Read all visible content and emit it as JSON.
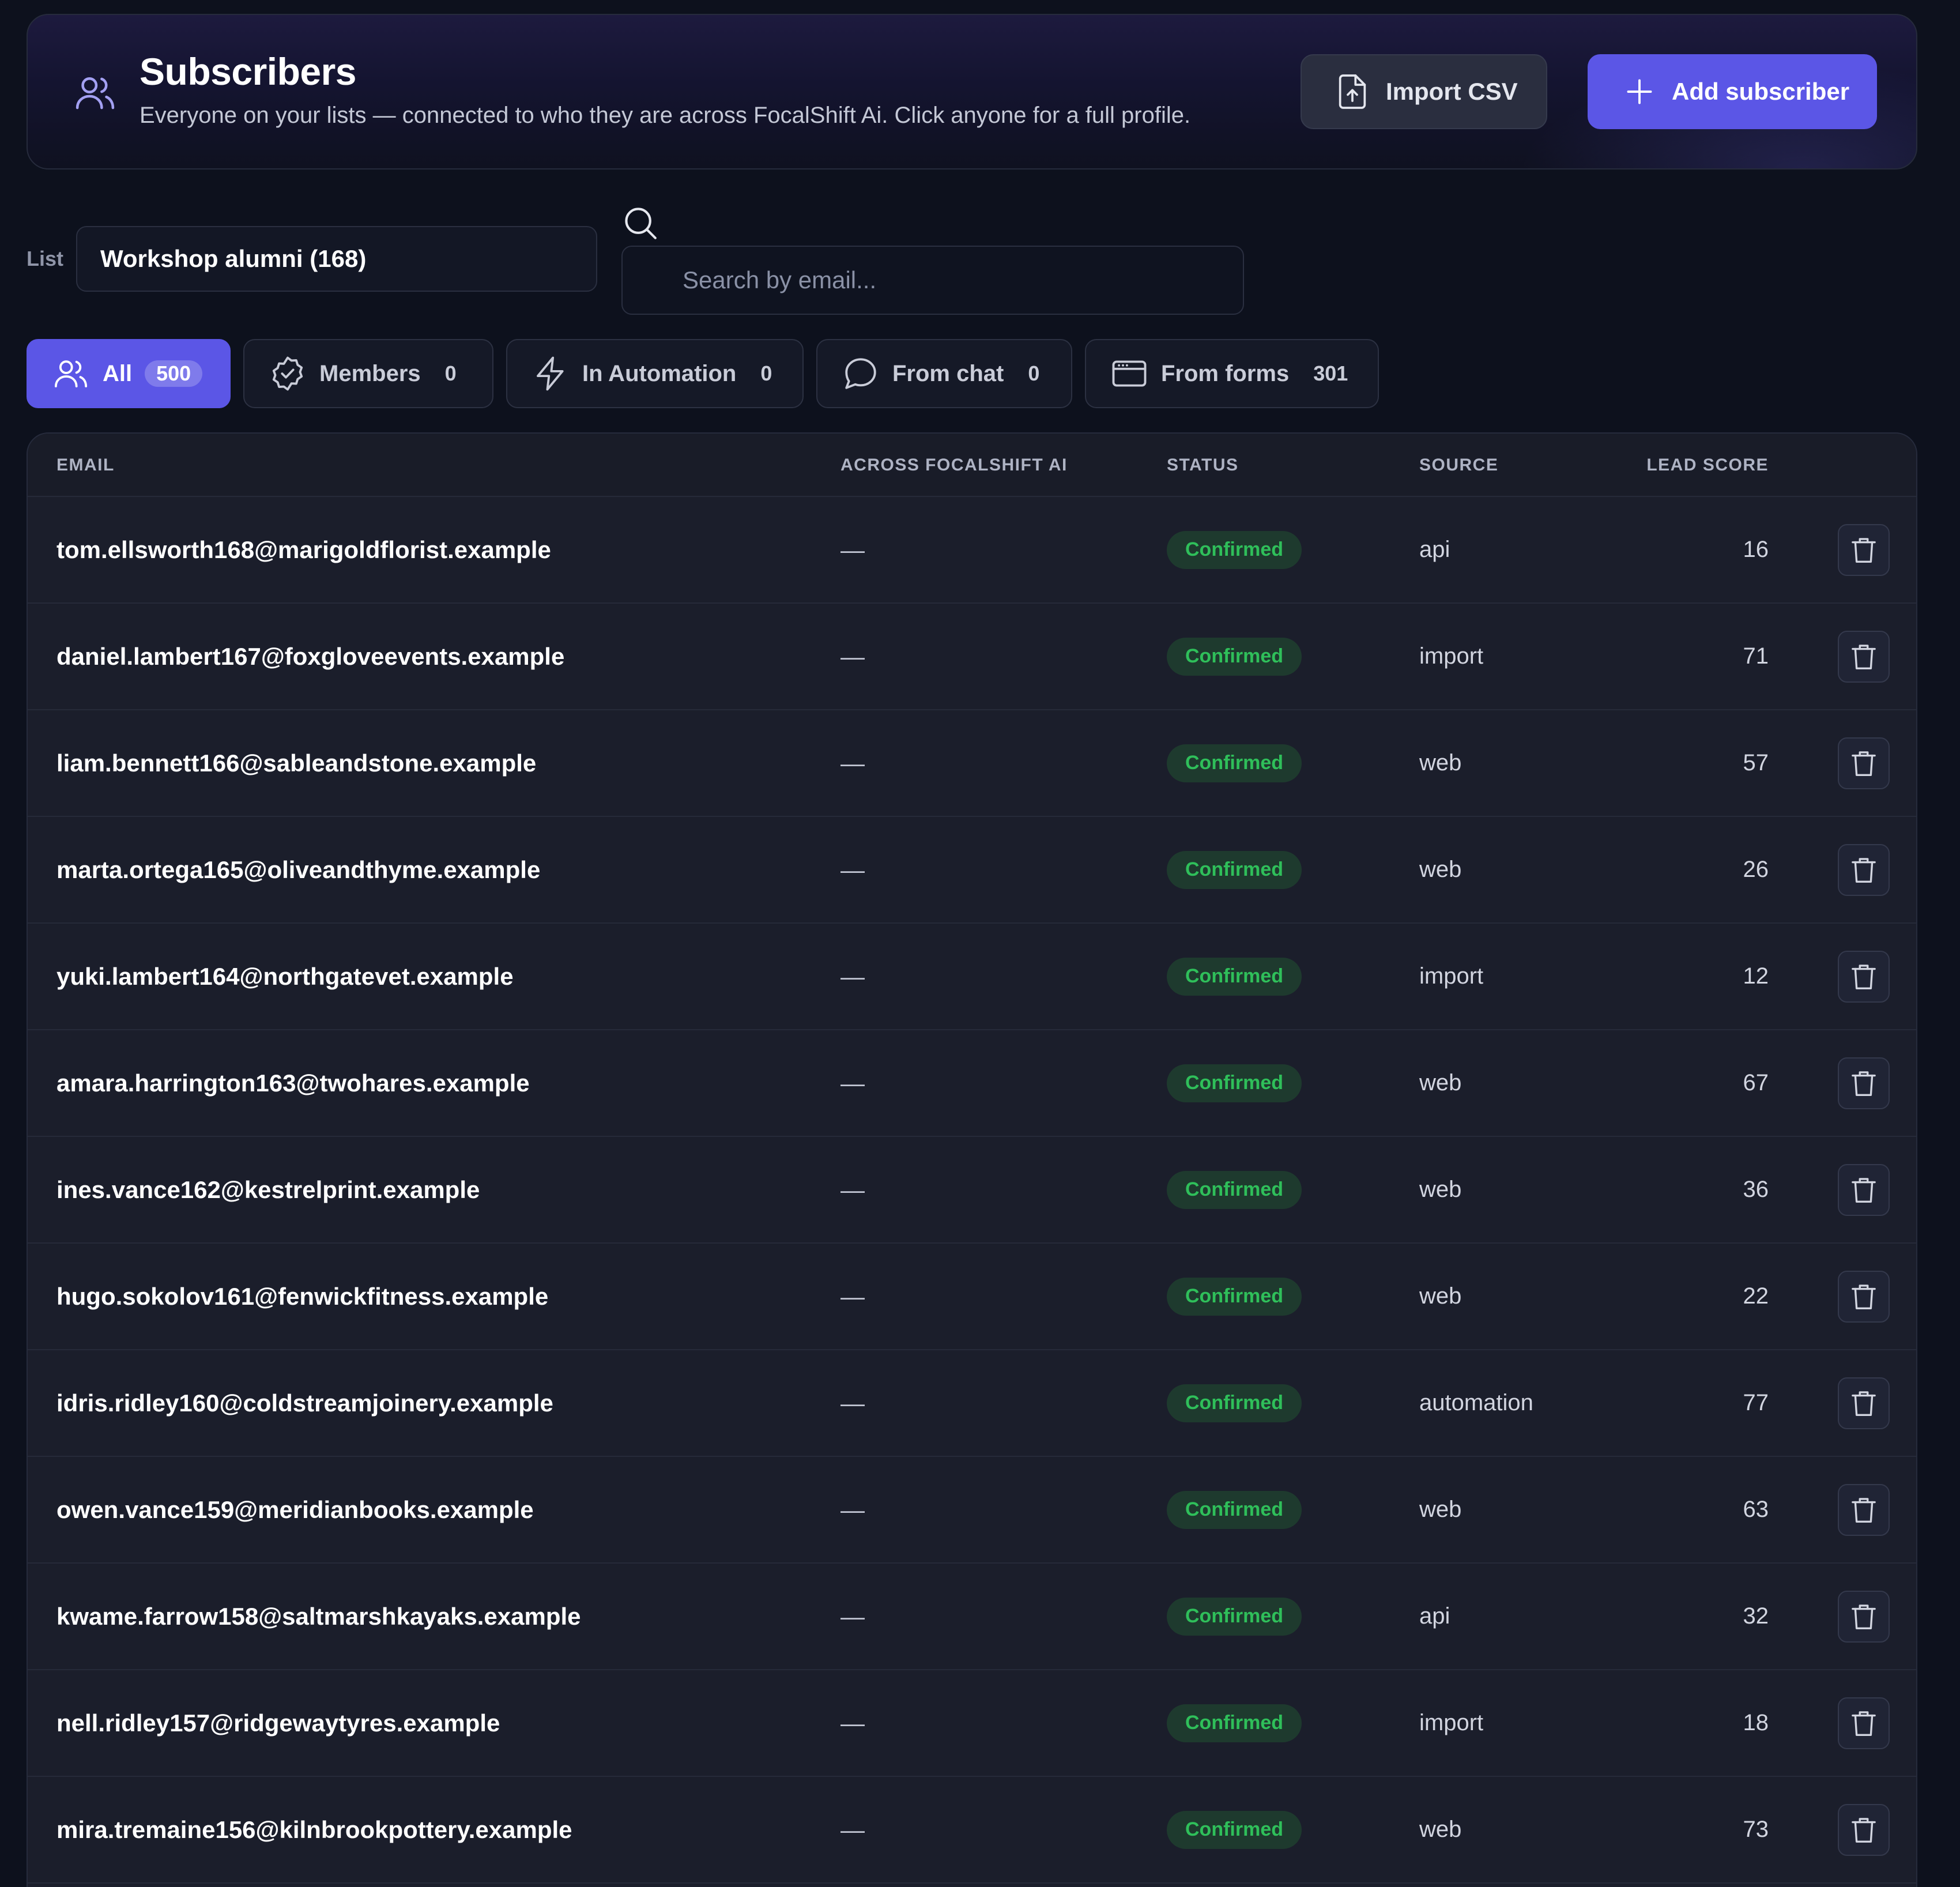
{
  "header": {
    "title": "Subscribers",
    "subtitle": "Everyone on your lists — connected to who they are across FocalShift Ai. Click anyone for a full profile.",
    "import_label": "Import CSV",
    "add_label": "Add subscriber",
    "accent_color": "#5b56e6"
  },
  "filters": {
    "list_label": "List",
    "list_value": "Workshop alumni (168)",
    "search_placeholder": "Search by email..."
  },
  "tabs": [
    {
      "label": "All",
      "count": "500",
      "icon": "users-icon",
      "active": true
    },
    {
      "label": "Members",
      "count": "0",
      "icon": "badge-check-icon",
      "active": false
    },
    {
      "label": "In Automation",
      "count": "0",
      "icon": "lightning-icon",
      "active": false
    },
    {
      "label": "From chat",
      "count": "0",
      "icon": "chat-bubble-icon",
      "active": false
    },
    {
      "label": "From forms",
      "count": "301",
      "icon": "browser-window-icon",
      "active": false
    }
  ],
  "table": {
    "columns": {
      "email": "EMAIL",
      "across": "ACROSS FOCALSHIFT AI",
      "status": "STATUS",
      "source": "SOURCE",
      "lead_score": "LEAD SCORE"
    },
    "rows": [
      {
        "email": "tom.ellsworth168@marigoldflorist.example",
        "across": "—",
        "status": "Confirmed",
        "source": "api",
        "score": "16"
      },
      {
        "email": "daniel.lambert167@foxgloveevents.example",
        "across": "—",
        "status": "Confirmed",
        "source": "import",
        "score": "71"
      },
      {
        "email": "liam.bennett166@sableandstone.example",
        "across": "—",
        "status": "Confirmed",
        "source": "web",
        "score": "57"
      },
      {
        "email": "marta.ortega165@oliveandthyme.example",
        "across": "—",
        "status": "Confirmed",
        "source": "web",
        "score": "26"
      },
      {
        "email": "yuki.lambert164@northgatevet.example",
        "across": "—",
        "status": "Confirmed",
        "source": "import",
        "score": "12"
      },
      {
        "email": "amara.harrington163@twohares.example",
        "across": "—",
        "status": "Confirmed",
        "source": "web",
        "score": "67"
      },
      {
        "email": "ines.vance162@kestrelprint.example",
        "across": "—",
        "status": "Confirmed",
        "source": "web",
        "score": "36"
      },
      {
        "email": "hugo.sokolov161@fenwickfitness.example",
        "across": "—",
        "status": "Confirmed",
        "source": "web",
        "score": "22"
      },
      {
        "email": "idris.ridley160@coldstreamjoinery.example",
        "across": "—",
        "status": "Confirmed",
        "source": "automation",
        "score": "77"
      },
      {
        "email": "owen.vance159@meridianbooks.example",
        "across": "—",
        "status": "Confirmed",
        "source": "web",
        "score": "63"
      },
      {
        "email": "kwame.farrow158@saltmarshkayaks.example",
        "across": "—",
        "status": "Confirmed",
        "source": "api",
        "score": "32"
      },
      {
        "email": "nell.ridley157@ridgewaytyres.example",
        "across": "—",
        "status": "Confirmed",
        "source": "import",
        "score": "18"
      },
      {
        "email": "mira.tremaine156@kilnbrookpottery.example",
        "across": "—",
        "status": "Confirmed",
        "source": "web",
        "score": "73"
      }
    ]
  }
}
